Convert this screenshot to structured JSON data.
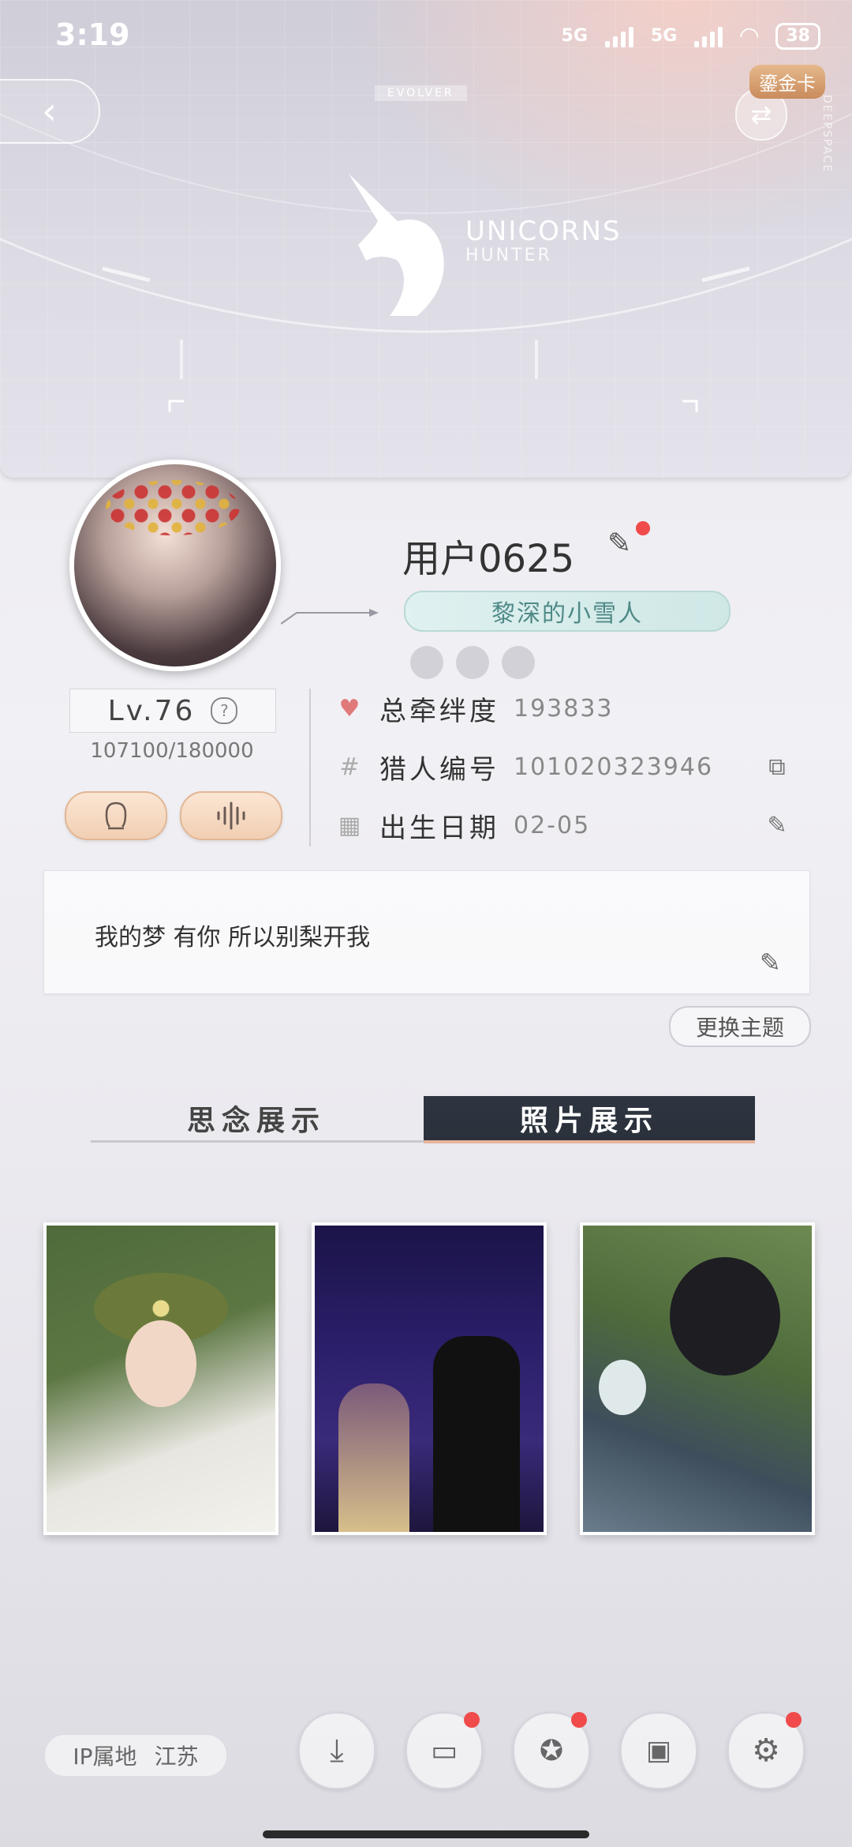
{
  "status": {
    "time": "3:19",
    "net1": "5G",
    "net2": "5G",
    "battery": "38"
  },
  "banner": {
    "evolver": "EVOLVER",
    "logo_title": "UNICORNS",
    "logo_sub": "HUNTER",
    "gold_badge": "鎏金卡",
    "vertical_text": "DEEPSPACE"
  },
  "profile": {
    "username": "用户0625",
    "title": "黎深的小雪人",
    "level": "Lv.76",
    "exp": "107100/180000"
  },
  "stats": [
    {
      "label": "总牵绊度",
      "value": "193833",
      "icon": "heart-icon"
    },
    {
      "label": "猎人编号",
      "value": "101020323946",
      "icon": "hash-icon"
    },
    {
      "label": "出生日期",
      "value": "02-05",
      "icon": "calendar-icon"
    }
  ],
  "signature": {
    "text": "我的梦 有你 所以别梨开我"
  },
  "theme_button": "更换主题",
  "tabs": {
    "tab1": "思念展示",
    "tab2": "照片展示",
    "active": "tab2"
  },
  "photos_count": 3,
  "footer": {
    "ip_label": "IP属地",
    "ip_value": "江苏"
  },
  "colors": {
    "accent": "#e6b49b",
    "red_dot": "#f04a4a",
    "pill_text": "#4f8a86",
    "tab_active_bg": "#2e3540"
  }
}
